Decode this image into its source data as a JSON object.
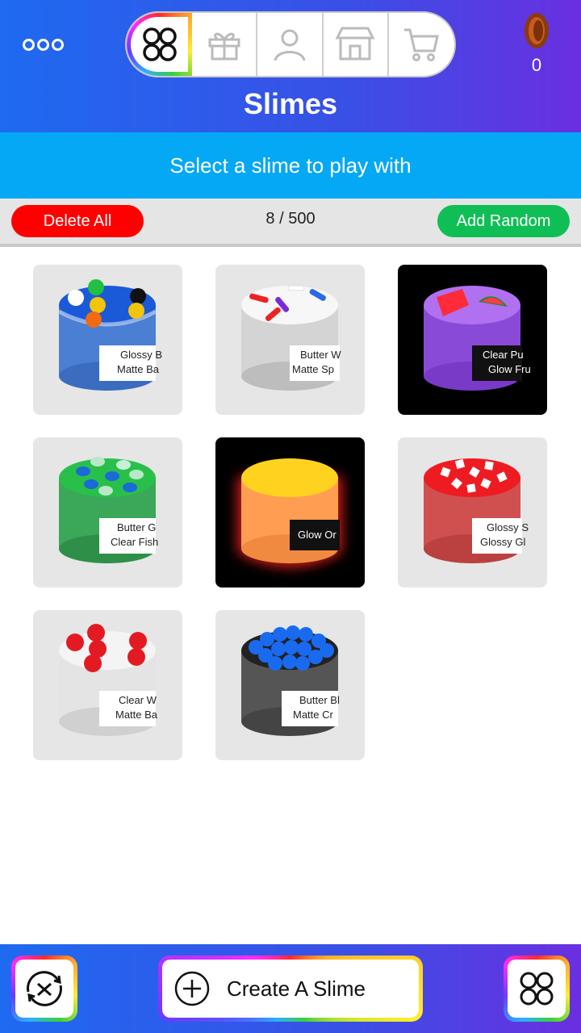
{
  "header": {
    "title": "Slimes",
    "coins": "0",
    "nav_tabs": [
      {
        "name": "collection",
        "icon": "grid-circles-icon"
      },
      {
        "name": "gifts",
        "icon": "gift-icon"
      },
      {
        "name": "profile",
        "icon": "person-icon"
      },
      {
        "name": "store",
        "icon": "storefront-icon"
      },
      {
        "name": "cart",
        "icon": "cart-icon"
      }
    ]
  },
  "banner": {
    "text": "Select a slime to play with"
  },
  "actions": {
    "delete_label": "Delete All",
    "count": "8 / 500",
    "random_label": "Add Random"
  },
  "slimes": [
    {
      "label1": "Glossy B",
      "label2": "Matte Ba",
      "jar_color": "#4a7fd4",
      "top_color": "#1a5ad8",
      "bg": "light"
    },
    {
      "label1": "Butter W",
      "label2": "Matte Sp",
      "jar_color": "#dcdcdc",
      "top_color": "#f4f4f4",
      "bg": "light"
    },
    {
      "label1": "Clear Pu",
      "label2": "Glow Fru",
      "jar_color": "#8a4ad8",
      "top_color": "#b070f0",
      "bg": "dark"
    },
    {
      "label1": "Butter G",
      "label2": "Clear Fish",
      "jar_color": "#3aa858",
      "top_color": "#28c04a",
      "bg": "light"
    },
    {
      "label1": "Glow Or",
      "label2": "",
      "jar_color": "#ff9e52",
      "top_color": "#ffd21f",
      "bg": "dark"
    },
    {
      "label1": "Glossy S",
      "label2": "Glossy Gl",
      "jar_color": "#d05050",
      "top_color": "#ee1c22",
      "bg": "light"
    },
    {
      "label1": "Clear W",
      "label2": "Matte Ba",
      "jar_color": "#e4e4e4",
      "top_color": "#f2f2f2",
      "bg": "light"
    },
    {
      "label1": "Butter Bl",
      "label2": "Matte Cr",
      "jar_color": "#555",
      "top_color": "#222",
      "bg": "light"
    }
  ],
  "bottom": {
    "create_label": "Create A Slime",
    "shuffle_icon": "shuffle-icon",
    "grid_icon": "grid-circles-icon"
  }
}
